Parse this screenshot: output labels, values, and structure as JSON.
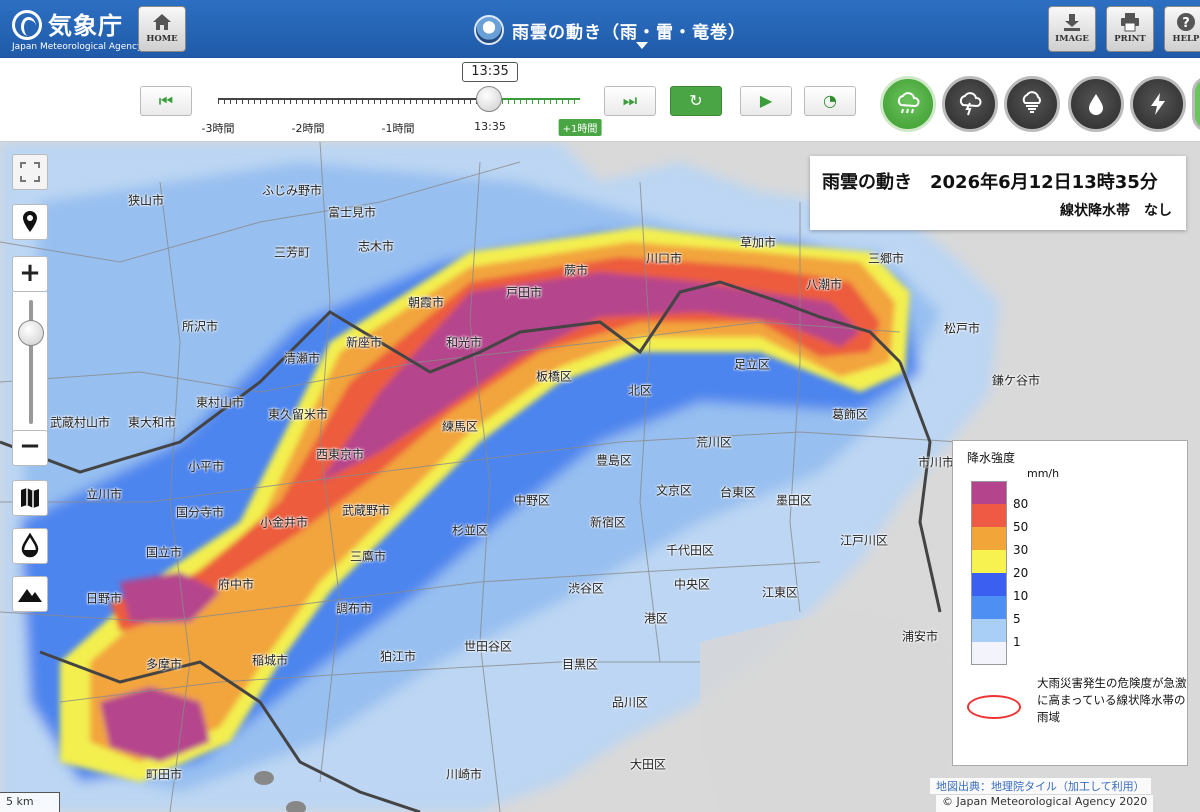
{
  "header": {
    "agency_name": "気象庁",
    "agency_name_en": "Japan Meteorological Agency",
    "home_label": "HOME",
    "title": "雨雲の動き（雨・雷・竜巻）",
    "image_label": "IMAGE",
    "print_label": "PRINT",
    "help_label": "HELP"
  },
  "timeline": {
    "current_time": "13:35",
    "ticks": [
      "-3時間",
      "-2時間",
      "-1時間",
      "13:35",
      "+1時間"
    ],
    "progress_fraction": 0.75
  },
  "layer_buttons": [
    "rain-cloud-icon",
    "thunder-icon",
    "tornado-icon",
    "rain-drop-icon",
    "lightning-icon"
  ],
  "info_panel": {
    "title": "雨雲の動き　2026年6月12日13時35分",
    "subtitle": "線状降水帯　なし"
  },
  "legend": {
    "title": "降水強度",
    "unit": "mm/h",
    "levels": [
      {
        "label": "80",
        "color": "#b4448c"
      },
      {
        "label": "50",
        "color": "#ef5a44"
      },
      {
        "label": "30",
        "color": "#f2a63a"
      },
      {
        "label": "20",
        "color": "#f7f24f"
      },
      {
        "label": "10",
        "color": "#3b5ff0"
      },
      {
        "label": "5",
        "color": "#4d8ff2"
      },
      {
        "label": "1",
        "color": "#a9cff7"
      },
      {
        "label": "",
        "color": "#f3f3fb"
      }
    ],
    "note": "大雨災害発生の危険度が急激に高まっている線状降水帯の雨域"
  },
  "map": {
    "places": [
      {
        "name": "ふじみ野市"
      },
      {
        "name": "富士見市"
      },
      {
        "name": "狭山市"
      },
      {
        "name": "三芳町"
      },
      {
        "name": "志木市"
      },
      {
        "name": "所沢市"
      },
      {
        "name": "朝霞市"
      },
      {
        "name": "新座市"
      },
      {
        "name": "和光市"
      },
      {
        "name": "戸田市"
      },
      {
        "name": "蕨市"
      },
      {
        "name": "川口市"
      },
      {
        "name": "草加市"
      },
      {
        "name": "八潮市"
      },
      {
        "name": "三郷市"
      },
      {
        "name": "清瀬市"
      },
      {
        "name": "板橋区"
      },
      {
        "name": "足立区"
      },
      {
        "name": "北区"
      },
      {
        "name": "葛飾区"
      },
      {
        "name": "東村山市"
      },
      {
        "name": "東久留米市"
      },
      {
        "name": "武蔵村山市"
      },
      {
        "name": "東大和市"
      },
      {
        "name": "練馬区"
      },
      {
        "name": "荒川区"
      },
      {
        "name": "西東京市"
      },
      {
        "name": "豊島区"
      },
      {
        "name": "小平市"
      },
      {
        "name": "立川市"
      },
      {
        "name": "国分寺市"
      },
      {
        "name": "小金井市"
      },
      {
        "name": "武蔵野市"
      },
      {
        "name": "中野区"
      },
      {
        "name": "文京区"
      },
      {
        "name": "台東区"
      },
      {
        "name": "墨田区"
      },
      {
        "name": "杉並区"
      },
      {
        "name": "新宿区"
      },
      {
        "name": "千代田区"
      },
      {
        "name": "国立市"
      },
      {
        "name": "三鷹市"
      },
      {
        "name": "府中市"
      },
      {
        "name": "渋谷区"
      },
      {
        "name": "中央区"
      },
      {
        "name": "江東区"
      },
      {
        "name": "江戸川区"
      },
      {
        "name": "日野市"
      },
      {
        "name": "調布市"
      },
      {
        "name": "港区"
      },
      {
        "name": "狛江市"
      },
      {
        "name": "世田谷区"
      },
      {
        "name": "浦安市"
      },
      {
        "name": "多摩市"
      },
      {
        "name": "稲城市"
      },
      {
        "name": "目黒区"
      },
      {
        "name": "品川区"
      },
      {
        "name": "町田市"
      },
      {
        "name": "大田区"
      },
      {
        "name": "川崎市"
      },
      {
        "name": "松戸市"
      },
      {
        "name": "鎌ケ谷市"
      },
      {
        "name": "市川市"
      }
    ]
  },
  "footer": {
    "scale": "5 km",
    "credit": "地図出典：地理院タイル（加工して利用）",
    "copyright": "© Japan Meteorological Agency 2020"
  }
}
